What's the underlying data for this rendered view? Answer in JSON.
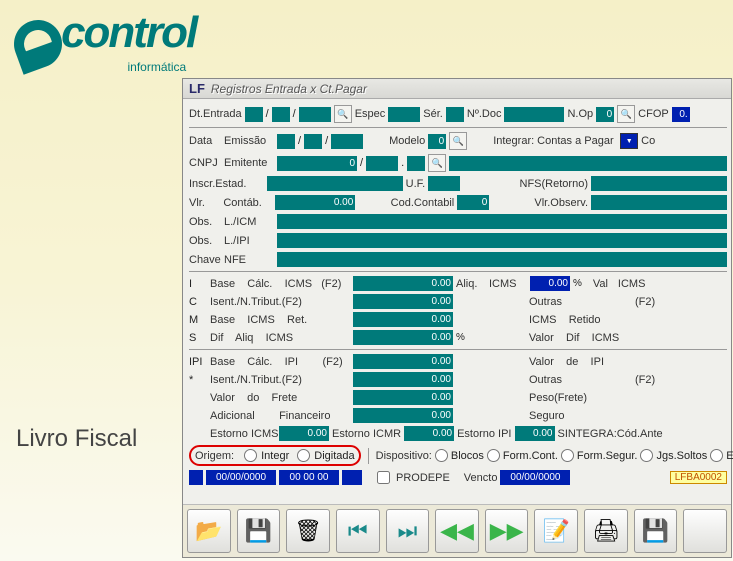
{
  "brand": {
    "name": "control",
    "subtitle": "informática"
  },
  "side_title": "Livro Fiscal",
  "window": {
    "prefix": "LF",
    "title": "Registros Entrada x Ct.Pagar"
  },
  "header": {
    "dtEntrada": "Dt.Entrada",
    "slash": "/",
    "espec": "Espec",
    "ser": "Sér.",
    "ndoc": "Nº.Doc",
    "nop": "N.Op",
    "nop_val": "0",
    "cfop": "CFOP",
    "cfop_val": "0."
  },
  "data_row": {
    "label": "Data",
    "emissao": "Emissão",
    "modelo": "Modelo",
    "modelo_val": "0",
    "integrar": "Integrar:",
    "integrar_opt": "Contas a Pagar",
    "co": "Co"
  },
  "cnpj": {
    "label": "CNPJ",
    "emitente": "Emitente",
    "val": "0",
    "slash": "/",
    "dot": "."
  },
  "inscr": {
    "label": "Inscr.Estad.",
    "uf": "U.F.",
    "nfs": "NFS(Retorno)"
  },
  "vlr": {
    "label": "Vlr.",
    "contab": "Contáb.",
    "val": "0.00",
    "codcontab": "Cod.Contabil",
    "codval": "0",
    "vlrobs": "Vlr.Observ."
  },
  "obs1": {
    "label": "Obs.",
    "sub": "L./ICM"
  },
  "obs2": {
    "label": "Obs.",
    "sub": "L./IPI"
  },
  "chave": {
    "label": "Chave",
    "nfe": "NFE"
  },
  "tax": {
    "i": {
      "k": "I",
      "l": "Base    Cálc.    ICMS   (F2)",
      "v": "0.00",
      "aliq": "Aliq.",
      "icms": "ICMS",
      "pct": "0.00",
      "pctunit": "%",
      "val": "Val",
      "valicms": "ICMS"
    },
    "c": {
      "k": "C",
      "l": "Isent./N.Tribut.(F2)",
      "v": "0.00",
      "out": "Outras",
      "f2": "(F2)"
    },
    "m": {
      "k": "M",
      "l": "Base    ICMS    Ret.",
      "v": "0.00",
      "icmsret": "ICMS    Retido"
    },
    "s": {
      "k": "S",
      "l": "Dif    Aliq    ICMS",
      "v": "0.00",
      "pctunit": "%",
      "valor": "Valor    Dif    ICMS"
    },
    "ipi": {
      "k": "IPI",
      "l": "Base    Cálc.    IPI        (F2)",
      "v": "0.00",
      "val": "Valor    de    IPI"
    },
    "star": {
      "k": "*",
      "l": "Isent./N.Tribut.(F2)",
      "v": "0.00",
      "out": "Outras",
      "f2": "(F2)"
    },
    "frete": {
      "l": "Valor    do    Frete",
      "v": "0.00",
      "peso": "Peso(Frete)"
    },
    "adic": {
      "l": "Adicional        Financeiro",
      "v": "0.00",
      "seg": "Seguro"
    },
    "est": {
      "l": "Estorno ICMS",
      "v": "0.00",
      "icmr": "Estorno ICMR",
      "icmrv": "0.00",
      "ipi": "Estorno IPI",
      "ipiv": "0.00",
      "sint": "SINTEGRA:Cód.Ante"
    }
  },
  "origem": {
    "label": "Origem:",
    "integr": "Integr",
    "digitada": "Digitada",
    "dispositivo": "Dispositivo:",
    "blocos": "Blocos",
    "formcont": "Form.Cont.",
    "formsegur": "Form.Segur.",
    "jgssoltos": "Jgs.Soltos",
    "ec": "EC"
  },
  "footer": {
    "date": "00/00/0000",
    "time": "00 00 00",
    "prodepe": "PRODEPE",
    "vencto": "Vencto",
    "vdate": "00/00/0000",
    "code": "LFBA0002"
  },
  "toolbar_icons": {
    "open": "📂",
    "save": "💾",
    "trash": "🗑",
    "first": "⏮",
    "last": "⏭",
    "prev": "◀◀",
    "next": "▶▶",
    "notes": "📝",
    "print": "🖨",
    "savealt": "💾"
  }
}
